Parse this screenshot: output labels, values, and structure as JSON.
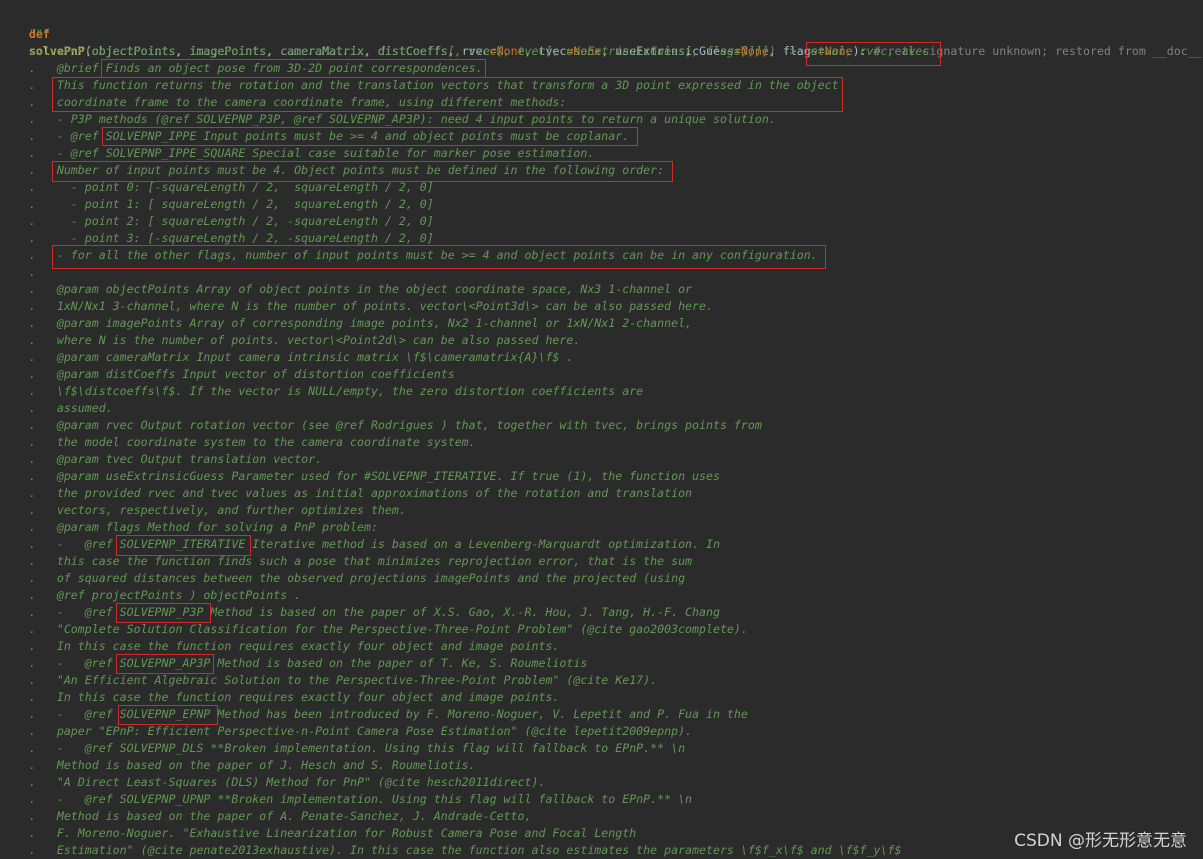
{
  "signature": {
    "def": "def",
    "name": "solvePnP",
    "open_paren": "(",
    "params_1": "objectPoints, imagePoints, cameraMatrix, distCoeffs, rvec",
    "eq1": "=",
    "none1": "None",
    "comma1": ", tvec",
    "eq2": "=",
    "none2": "None",
    "comma2": ", useExtrinsicGuess",
    "eq3": "=",
    "none3": "None",
    "comma3": ", flags",
    "eq4": "=",
    "none4": "None",
    "close": "):",
    "comment": " # real signature unknown; restored from __doc__"
  },
  "doc_lines": [
    "    \"\"\"",
    "    solvePnP(objectPoints, imagePoints, cameraMatrix, distCoeffs[, rvec[, tvec[, useExtrinsicGuess[, flags]]]]) -> retval, rvec, tvec",
    "    .   @brief Finds an object pose from 3D-2D point correspondences.",
    "    .   This function returns the rotation and the translation vectors that transform a 3D point expressed in the object",
    "    .   coordinate frame to the camera coordinate frame, using different methods:",
    "    .   - P3P methods (@ref SOLVEPNP_P3P, @ref SOLVEPNP_AP3P): need 4 input points to return a unique solution.",
    "    .   - @ref SOLVEPNP_IPPE Input points must be >= 4 and object points must be coplanar.",
    "    .   - @ref SOLVEPNP_IPPE_SQUARE Special case suitable for marker pose estimation.",
    "    .   Number of input points must be 4. Object points must be defined in the following order:",
    "    .     - point 0: [-squareLength / 2,  squareLength / 2, 0]",
    "    .     - point 1: [ squareLength / 2,  squareLength / 2, 0]",
    "    .     - point 2: [ squareLength / 2, -squareLength / 2, 0]",
    "    .     - point 3: [-squareLength / 2, -squareLength / 2, 0]",
    "    .   - for all the other flags, number of input points must be >= 4 and object points can be in any configuration.",
    "    .",
    "    .   @param objectPoints Array of object points in the object coordinate space, Nx3 1-channel or",
    "    .   1xN/Nx1 3-channel, where N is the number of points. vector\\<Point3d\\> can be also passed here.",
    "    .   @param imagePoints Array of corresponding image points, Nx2 1-channel or 1xN/Nx1 2-channel,",
    "    .   where N is the number of points. vector\\<Point2d\\> can be also passed here.",
    "    .   @param cameraMatrix Input camera intrinsic matrix \\f$\\cameramatrix{A}\\f$ .",
    "    .   @param distCoeffs Input vector of distortion coefficients",
    "    .   \\f$\\distcoeffs\\f$. If the vector is NULL/empty, the zero distortion coefficients are",
    "    .   assumed.",
    "    .   @param rvec Output rotation vector (see @ref Rodrigues ) that, together with tvec, brings points from",
    "    .   the model coordinate system to the camera coordinate system.",
    "    .   @param tvec Output translation vector.",
    "    .   @param useExtrinsicGuess Parameter used for #SOLVEPNP_ITERATIVE. If true (1), the function uses",
    "    .   the provided rvec and tvec values as initial approximations of the rotation and translation",
    "    .   vectors, respectively, and further optimizes them.",
    "    .   @param flags Method for solving a PnP problem:",
    "    .   -   @ref SOLVEPNP_ITERATIVE Iterative method is based on a Levenberg-Marquardt optimization. In",
    "    .   this case the function finds such a pose that minimizes reprojection error, that is the sum",
    "    .   of squared distances between the observed projections imagePoints and the projected (using",
    "    .   @ref projectPoints ) objectPoints .",
    "    .   -   @ref SOLVEPNP_P3P Method is based on the paper of X.S. Gao, X.-R. Hou, J. Tang, H.-F. Chang",
    "    .   \"Complete Solution Classification for the Perspective-Three-Point Problem\" (@cite gao2003complete).",
    "    .   In this case the function requires exactly four object and image points.",
    "    .   -   @ref SOLVEPNP_AP3P Method is based on the paper of T. Ke, S. Roumeliotis",
    "    .   \"An Efficient Algebraic Solution to the Perspective-Three-Point Problem\" (@cite Ke17).",
    "    .   In this case the function requires exactly four object and image points.",
    "    .   -   @ref SOLVEPNP_EPNP Method has been introduced by F. Moreno-Noguer, V. Lepetit and P. Fua in the",
    "    .   paper \"EPnP: Efficient Perspective-n-Point Camera Pose Estimation\" (@cite lepetit2009epnp).",
    "    .   -   @ref SOLVEPNP_DLS **Broken implementation. Using this flag will fallback to EPnP.** \\n",
    "    .   Method is based on the paper of J. Hesch and S. Roumeliotis.",
    "    .   \"A Direct Least-Squares (DLS) Method for PnP\" (@cite hesch2011direct).",
    "    .   -   @ref SOLVEPNP_UPNP **Broken implementation. Using this flag will fallback to EPnP.** \\n",
    "    .   Method is based on the paper of A. Penate-Sanchez, J. Andrade-Cetto,",
    "    .   F. Moreno-Noguer. \"Exhaustive Linearization for Robust Camera Pose and Focal Length",
    "    .   Estimation\" (@cite penate2013exhaustive). In this case the function also estimates the parameters \\f$f_x\\f$ and \\f$f_y\\f$"
  ],
  "highlights": [
    {
      "text": "retval, rvec, tvec"
    },
    {
      "text": "Finds an object pose from 3D-2D point correspondences."
    },
    {
      "text": "This function returns the rotation and the translation vectors (2 lines)"
    },
    {
      "text": "SOLVEPNP_IPPE Input points must be >= 4 and object points must be coplanar."
    },
    {
      "text": "Number of input points must be 4. Object points must be defined in the following order:"
    },
    {
      "text": "- for all the other flags, number of input points must be >= 4 and object points can be in any configuration."
    },
    {
      "text": "SOLVEPNP_ITERATIVE"
    },
    {
      "text": "SOLVEPNP_P3P"
    },
    {
      "text": "SOLVEPNP_AP3P"
    },
    {
      "text": "SOLVEPNP_EPNP"
    }
  ],
  "watermark": "CSDN @形无形意无意",
  "colors": {
    "background": "#2b2b2b",
    "docstring": "#629755",
    "keyword": "#cc7832",
    "function_name": "#ffc66d",
    "identifier": "#a9b7c6",
    "comment": "#808080",
    "highlight_box": "#d22b2b"
  }
}
